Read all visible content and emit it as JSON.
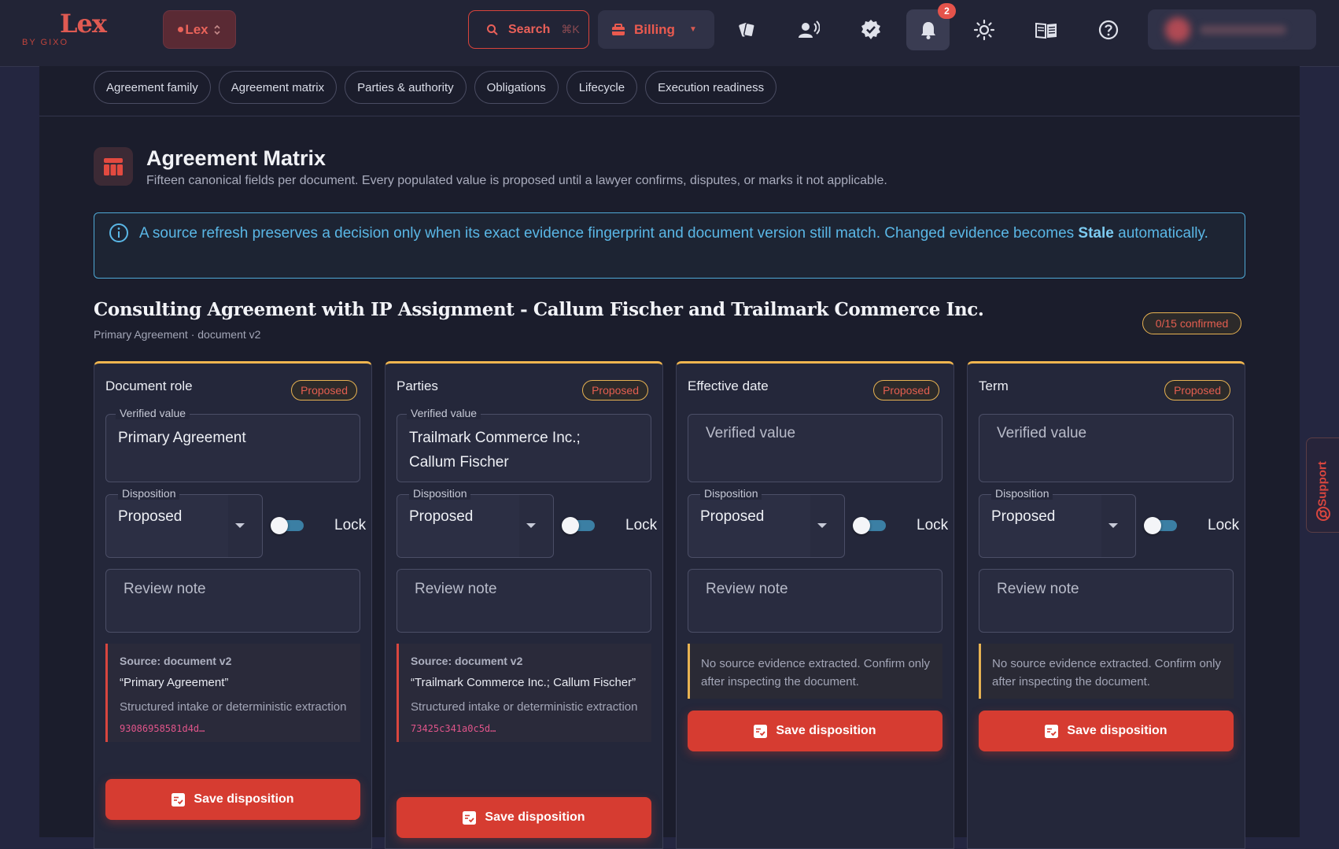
{
  "app": {
    "logo": "Lex",
    "logo_sub": "BY GIXO",
    "workspace": "Lex"
  },
  "topbar": {
    "search_label": "Search",
    "search_shortcut": "⌘K",
    "billing_label": "Billing",
    "notification_count": "2",
    "icons": [
      "cards-icon",
      "speaker-user-icon",
      "verified-badge-icon",
      "bell-icon",
      "sun-icon",
      "book-icon",
      "help-icon"
    ]
  },
  "tabs": [
    "Agreement family",
    "Agreement matrix",
    "Parties & authority",
    "Obligations",
    "Lifecycle",
    "Execution readiness"
  ],
  "page": {
    "title": "Agreement Matrix",
    "subtitle": "Fifteen canonical fields per document. Every populated value is proposed until a lawyer confirms, disputes, or marks it not applicable."
  },
  "info": {
    "text_before": "A source refresh preserves a decision only when its exact evidence fingerprint and document version still match. Changed evidence becomes ",
    "text_bold": "Stale",
    "text_after": " automatically."
  },
  "document": {
    "title": "Consulting Agreement with IP Assignment - Callum Fischer and Trailmark Commerce Inc.",
    "subtitle": "Primary Agreement · document v2",
    "confirmed": "0/15 confirmed"
  },
  "labels": {
    "verified_value": "Verified value",
    "disposition": "Disposition",
    "lock": "Lock",
    "review_note": "Review note",
    "save": "Save disposition",
    "support": "Support"
  },
  "cards": [
    {
      "field": "Document role",
      "status": "Proposed",
      "value": "Primary Agreement",
      "disposition": "Proposed",
      "source_heading": "Source: document v2",
      "source_quote": "“Primary Agreement”",
      "source_method": "Structured intake or deterministic extraction",
      "source_hash": "93086958581d4d…"
    },
    {
      "field": "Parties",
      "status": "Proposed",
      "value": "Trailmark Commerce Inc.; Callum Fischer",
      "disposition": "Proposed",
      "source_heading": "Source: document v2",
      "source_quote": "“Trailmark Commerce Inc.; Callum Fischer”",
      "source_method": "Structured intake or deterministic extraction",
      "source_hash": "73425c341a0c5d…"
    },
    {
      "field": "Effective date",
      "status": "Proposed",
      "value": "",
      "disposition": "Proposed",
      "no_source": "No source evidence extracted. Confirm only after inspecting the document."
    },
    {
      "field": "Term",
      "status": "Proposed",
      "value": "",
      "disposition": "Proposed",
      "no_source": "No source evidence extracted. Confirm only after inspecting the document."
    }
  ],
  "colors": {
    "accent": "#d63c31",
    "warning": "#e7b252",
    "info": "#5ab7e6",
    "background": "#1b1d2c"
  }
}
